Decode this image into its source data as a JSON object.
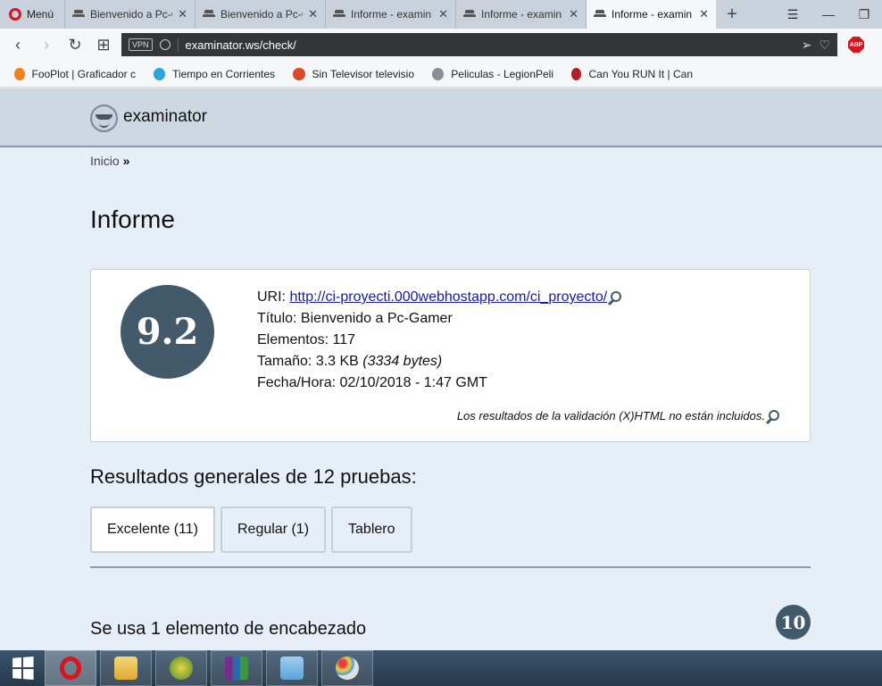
{
  "browser": {
    "menu_label": "Menú",
    "tabs": [
      {
        "title": "Bienvenido a Pc-G",
        "active": false
      },
      {
        "title": "Bienvenido a Pc-G",
        "active": false
      },
      {
        "title": "Informe - examin",
        "active": false
      },
      {
        "title": "Informe - examin",
        "active": false
      },
      {
        "title": "Informe - examin",
        "active": true
      }
    ],
    "vpn_label": "VPN",
    "url": "examinator.ws/check/",
    "abp_label": "ABP",
    "bookmarks": [
      {
        "label": "FooPlot | Graficador c",
        "color": "#f0821e"
      },
      {
        "label": "Tiempo en Corrientes",
        "color": "#2aa6d8"
      },
      {
        "label": "Sin Televisor televisio",
        "color": "#d84a2a"
      },
      {
        "label": "Peliculas - LegionPeli",
        "color": "#8a8f96"
      },
      {
        "label": "Can You RUN It | Can",
        "color": "#b3202c"
      }
    ]
  },
  "site": {
    "logo_text": "examinator",
    "breadcrumb": {
      "home": "Inicio",
      "sep": "»"
    },
    "page_title": "Informe"
  },
  "report": {
    "score": "9.2",
    "uri_label": "URI: ",
    "uri": "http://ci-proyecti.000webhostapp.com/ci_proyecto/",
    "title_label": "Título: ",
    "title": "Bienvenido a Pc-Gamer",
    "elements_label": "Elementos: ",
    "elements": "117",
    "size_label": "Tamaño: ",
    "size": "3.3 KB",
    "size_bytes": "(3334 bytes)",
    "datetime_label": "Fecha/Hora: ",
    "datetime": "02/10/2018 - 1:47 GMT",
    "note": "Los resultados de la validación (X)HTML no están incluidos."
  },
  "results": {
    "heading": "Resultados generales de 12 pruebas:",
    "tabs": [
      {
        "label": "Excelente (11)",
        "active": true
      },
      {
        "label": "Regular (1)",
        "active": false
      },
      {
        "label": "Tablero",
        "active": false
      }
    ],
    "badge": "10",
    "section_heading": "Se usa 1 elemento de encabezado"
  },
  "colors": {
    "accent": "#435a6b",
    "header_bg": "#ced8e3",
    "page_bg": "#e6eef7"
  }
}
